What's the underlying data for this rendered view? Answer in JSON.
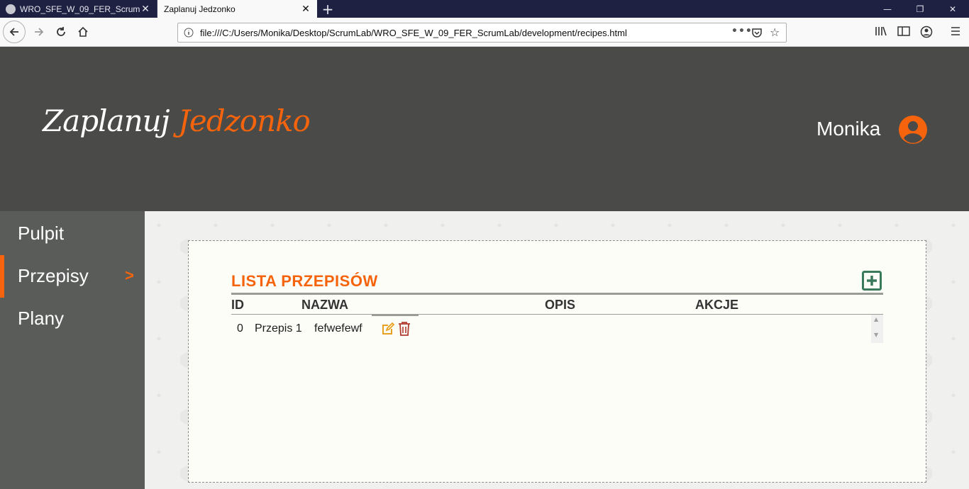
{
  "browser": {
    "tabs": [
      {
        "title": "WRO_SFE_W_09_FER_ScrumLab",
        "active": false
      },
      {
        "title": "Zaplanuj Jedzonko",
        "active": true
      }
    ],
    "new_tab_label": "+",
    "close_glyph": "✕",
    "url": "file:///C:/Users/Monika/Desktop/ScrumLab/WRO_SFE_W_09_FER_ScrumLab/development/recipes.html",
    "page_actions": "•••",
    "window_controls": {
      "minimize": "—",
      "restore": "❐",
      "close": "✕"
    }
  },
  "header": {
    "logo_part1": "Zaplanuj",
    "logo_part2": "Jedzonko",
    "user_name": "Monika"
  },
  "sidebar": {
    "items": [
      {
        "label": "Pulpit",
        "active": false
      },
      {
        "label": "Przepisy",
        "active": true,
        "arrow": ">"
      },
      {
        "label": "Plany",
        "active": false
      }
    ]
  },
  "main": {
    "title": "LISTA PRZEPISÓW",
    "columns": [
      "ID",
      "NAZWA",
      "OPIS",
      "AKCJE"
    ],
    "rows": [
      {
        "id": "0",
        "name": "Przepis 1",
        "description": "fefwefewf"
      }
    ]
  },
  "colors": {
    "accent": "#f5640c",
    "header_bg": "#4a4a48",
    "sidebar_bg": "#5a5c5a",
    "add_icon": "#3a7a5a",
    "edit_icon": "#e8a020",
    "delete_icon": "#b03a2e"
  }
}
